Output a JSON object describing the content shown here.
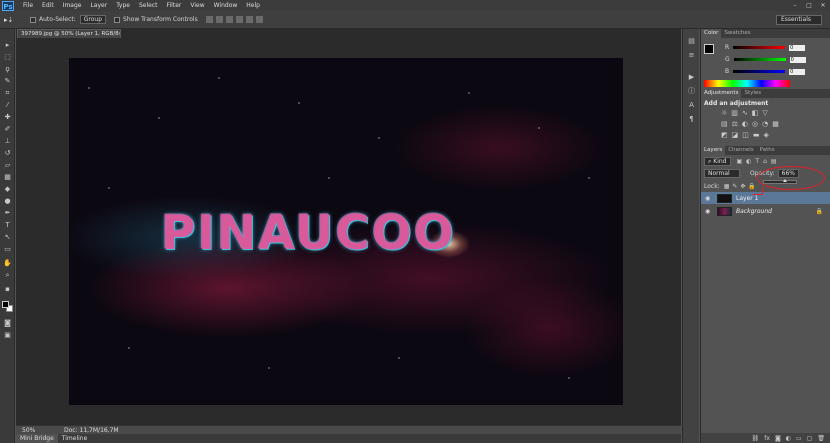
{
  "menubar": {
    "logo": "Ps",
    "items": [
      "File",
      "Edit",
      "Image",
      "Layer",
      "Type",
      "Select",
      "Filter",
      "View",
      "Window",
      "Help"
    ],
    "window_controls": [
      "–",
      "□",
      "✕"
    ]
  },
  "options": {
    "tool_glyph": "▸⇣",
    "auto_select_label": "Auto-Select:",
    "auto_select_value": "Group",
    "show_transform_label": "Show Transform Controls",
    "workspace": "Essentials"
  },
  "document": {
    "tab_title": "397989.jpg @ 50% (Layer 1, RGB/8#) *",
    "artwork_text": "PINAUCOO",
    "zoom": "50%",
    "doc_size": "Doc: 11,7M/16,7M"
  },
  "bottom_tabs": [
    "Mini Bridge",
    "Timeline"
  ],
  "color_panel": {
    "tabs": [
      "Color",
      "Swatches"
    ],
    "channels": [
      {
        "label": "R",
        "value": "0",
        "from": "#000000",
        "to": "#ff0000"
      },
      {
        "label": "G",
        "value": "0",
        "from": "#000000",
        "to": "#00ff00"
      },
      {
        "label": "B",
        "value": "0",
        "from": "#000000",
        "to": "#0000ff"
      }
    ]
  },
  "adjustments_panel": {
    "tabs": [
      "Adjustments",
      "Styles"
    ],
    "heading": "Add an adjustment"
  },
  "layers_panel": {
    "tabs": [
      "Layers",
      "Channels",
      "Paths"
    ],
    "filter_kind": "Kind",
    "blend_mode": "Normal",
    "opacity_label": "Opacity:",
    "opacity_value": "66%",
    "opacity_level": 0.66,
    "lock_label": "Lock:",
    "layers": [
      {
        "name": "Layer 1",
        "selected": true
      },
      {
        "name": "Background",
        "selected": false
      }
    ]
  }
}
